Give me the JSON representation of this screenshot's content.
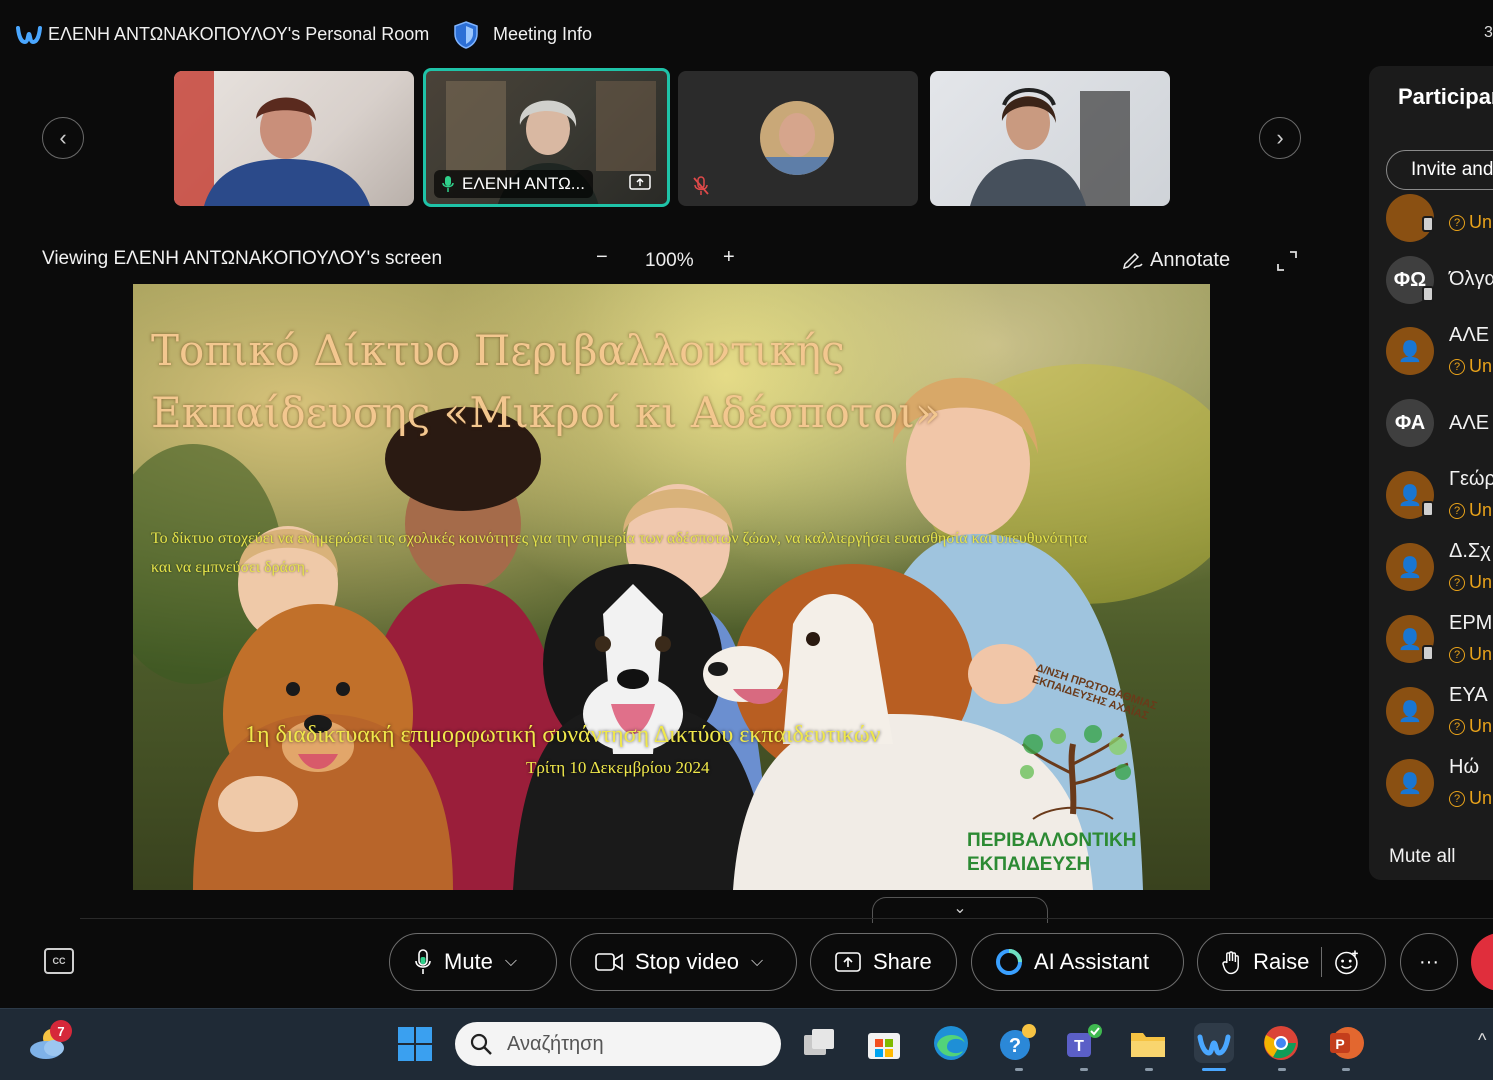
{
  "window": {
    "room_title": "ΕΛΕΝΗ ΑΝΤΩΝΑΚΟΠΟΥΛΟΥ's Personal Room",
    "meeting_info": "Meeting Info",
    "edge_glyph": "3"
  },
  "video_strip": {
    "tiles": [
      {
        "name": "",
        "muted": false
      },
      {
        "name": "ΕΛΕΝΗ ΑΝΤΩ...",
        "active": true,
        "sharing": true
      },
      {
        "name": "",
        "muted": true
      },
      {
        "name": "",
        "muted": false
      }
    ]
  },
  "viewing": {
    "label": "Viewing ΕΛΕΝΗ ΑΝΤΩΝΑΚΟΠΟΥΛΟΥ's screen",
    "zoom_out": "−",
    "zoom_level": "100%",
    "zoom_in": "+",
    "annotate": "Annotate"
  },
  "slide": {
    "title_line1": "Τοπικό Δίκτυο Περιβαλλοντικής",
    "title_line2": "Εκπαίδευσης «Μικροί κι Αδέσποτοι»",
    "description": "Το δίκτυο στοχεύει να ενημερώσει τις σχολικές κοινότητες για την σημερία των αδέσποτων ζώων, να καλλιεργήσει ευαισθησία και υπευθυνότητα και να εμπνεύσει δράση.",
    "meeting": "1η διαδικτυακή επιμορφωτική συνάντηση Δικτύου εκπαιδευτικών",
    "date": "Τρίτη 10 Δεκεμβρίου 2024",
    "org_arc": "Δ/ΝΣΗ ΠΡΩΤΟΒΑΘΜΙΑΣ ΕΚΠΑΙΔΕΥΣΗΣ ΑΧΑΪΑΣ",
    "org_line1": "ΠΕΡΙΒΑΛΛΟΝΤΙΚΗ",
    "org_line2": "ΕΚΠΑΙΔΕΥΣΗ"
  },
  "participants_panel": {
    "title": "Participants",
    "invite": "Invite and remind",
    "mute_all": "Mute all",
    "items": [
      {
        "initials": "",
        "name": "",
        "status": "Unmuted"
      },
      {
        "initials": "ΦΩ",
        "name": "Όλγα",
        "status": ""
      },
      {
        "initials": "",
        "name": "ΑΛΕ",
        "status": "Unmuted"
      },
      {
        "initials": "ΦΑ",
        "name": "ΑΛΕ",
        "status": ""
      },
      {
        "initials": "",
        "name": "Γεώρ",
        "status": "Unmuted"
      },
      {
        "initials": "",
        "name": "Δ.Σχ",
        "status": "Unmuted"
      },
      {
        "initials": "",
        "name": "ΕΡΜ",
        "status": "Unmuted"
      },
      {
        "initials": "",
        "name": "ΕΥΑ",
        "status": "Unmuted"
      },
      {
        "initials": "",
        "name": "Ηώ",
        "status": "Unmuted"
      }
    ]
  },
  "controls": {
    "cc": "CC",
    "mute": "Mute",
    "stop_video": "Stop video",
    "share": "Share",
    "ai_assistant": "AI Assistant",
    "raise": "Raise",
    "more": "···"
  },
  "taskbar": {
    "weather_badge": "7",
    "search_placeholder": "Αναζήτηση"
  },
  "colors": {
    "accent_active": "#1fc3a8",
    "leave": "#e02e3c",
    "status_warning": "#e8a21a",
    "avatar_brown": "#8a5012"
  }
}
